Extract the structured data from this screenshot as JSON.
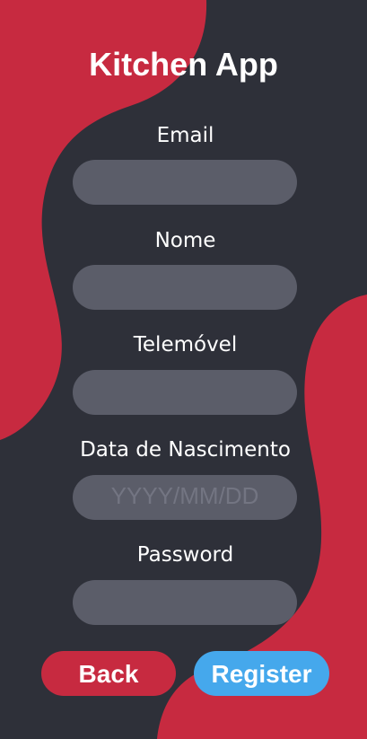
{
  "app": {
    "title": "Kitchen App"
  },
  "form": {
    "email": {
      "label": "Email",
      "value": "",
      "placeholder": ""
    },
    "nome": {
      "label": "Nome",
      "value": "",
      "placeholder": ""
    },
    "telemovel": {
      "label": "Telemóvel",
      "value": "",
      "placeholder": ""
    },
    "data_nascimento": {
      "label": "Data de Nascimento",
      "value": "",
      "placeholder": "YYYY/MM/DD"
    },
    "password": {
      "label": "Password",
      "value": "",
      "placeholder": ""
    }
  },
  "buttons": {
    "back_label": "Back",
    "register_label": "Register"
  },
  "colors": {
    "background": "#2e3039",
    "accent_red": "#c72a40",
    "input_fill": "#5b5d69",
    "register_blue": "#45a8ec"
  }
}
